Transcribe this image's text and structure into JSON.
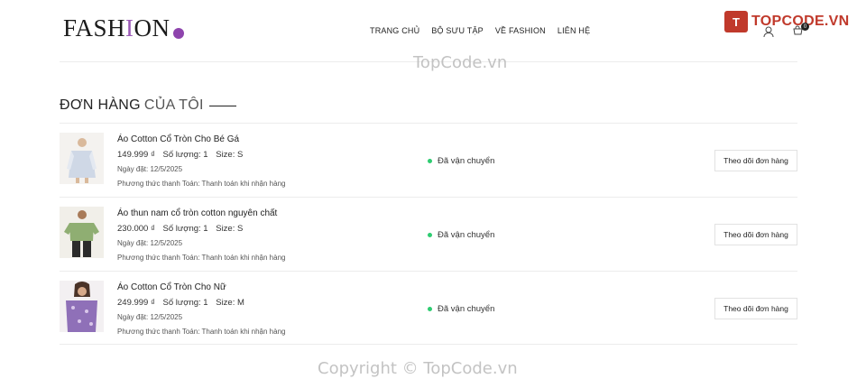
{
  "brand": {
    "logo_text_1": "FASH",
    "logo_text_2": "I",
    "logo_text_3": "ON",
    "accent": "#8e44ad"
  },
  "nav": [
    "TRANG CHỦ",
    "BỘ SƯU TẬP",
    "VỀ FASHION",
    "LIÊN HỆ"
  ],
  "badge": {
    "mark": "T",
    "text": "TOPCODE.VN"
  },
  "header_icons": {
    "user_icon": "user-icon",
    "cart_icon": "cart-icon",
    "cart_count": "0"
  },
  "watermark": {
    "top": "TopCode.vn",
    "bottom": "Copyright © TopCode.vn"
  },
  "page": {
    "title_strong": "ĐƠN HÀNG",
    "title_light": "CỦA TÔI"
  },
  "orders": [
    {
      "name": "Áo Cotton Cổ Tròn Cho Bé Gá",
      "price": "149.999 ₫",
      "quantity": "Số lượng: 1",
      "size": "Size: S",
      "date": "Ngày đặt: 12/5/2025",
      "payment": "Phương thức thanh Toán: Thanh toán khi nhận hàng",
      "status": "Đã vận chuyển",
      "button": "Theo dõi đơn hàng"
    },
    {
      "name": "Áo thun nam cổ tròn cotton nguyên chất",
      "price": "230.000 ₫",
      "quantity": "Số lượng: 1",
      "size": "Size: S",
      "date": "Ngày đặt: 12/5/2025",
      "payment": "Phương thức thanh Toán: Thanh toán khi nhận hàng",
      "status": "Đã vận chuyển",
      "button": "Theo dõi đơn hàng"
    },
    {
      "name": "Áo Cotton Cổ Tròn Cho Nữ",
      "price": "249.999 ₫",
      "quantity": "Số lượng: 1",
      "size": "Size: M",
      "date": "Ngày đặt: 12/5/2025",
      "payment": "Phương thức thanh Toán: Thanh toán khi nhận hàng",
      "status": "Đã vận chuyển",
      "button": "Theo dõi đơn hàng"
    }
  ],
  "colors": {
    "status_dot": "#2ecc71",
    "divider": "#ececec"
  }
}
